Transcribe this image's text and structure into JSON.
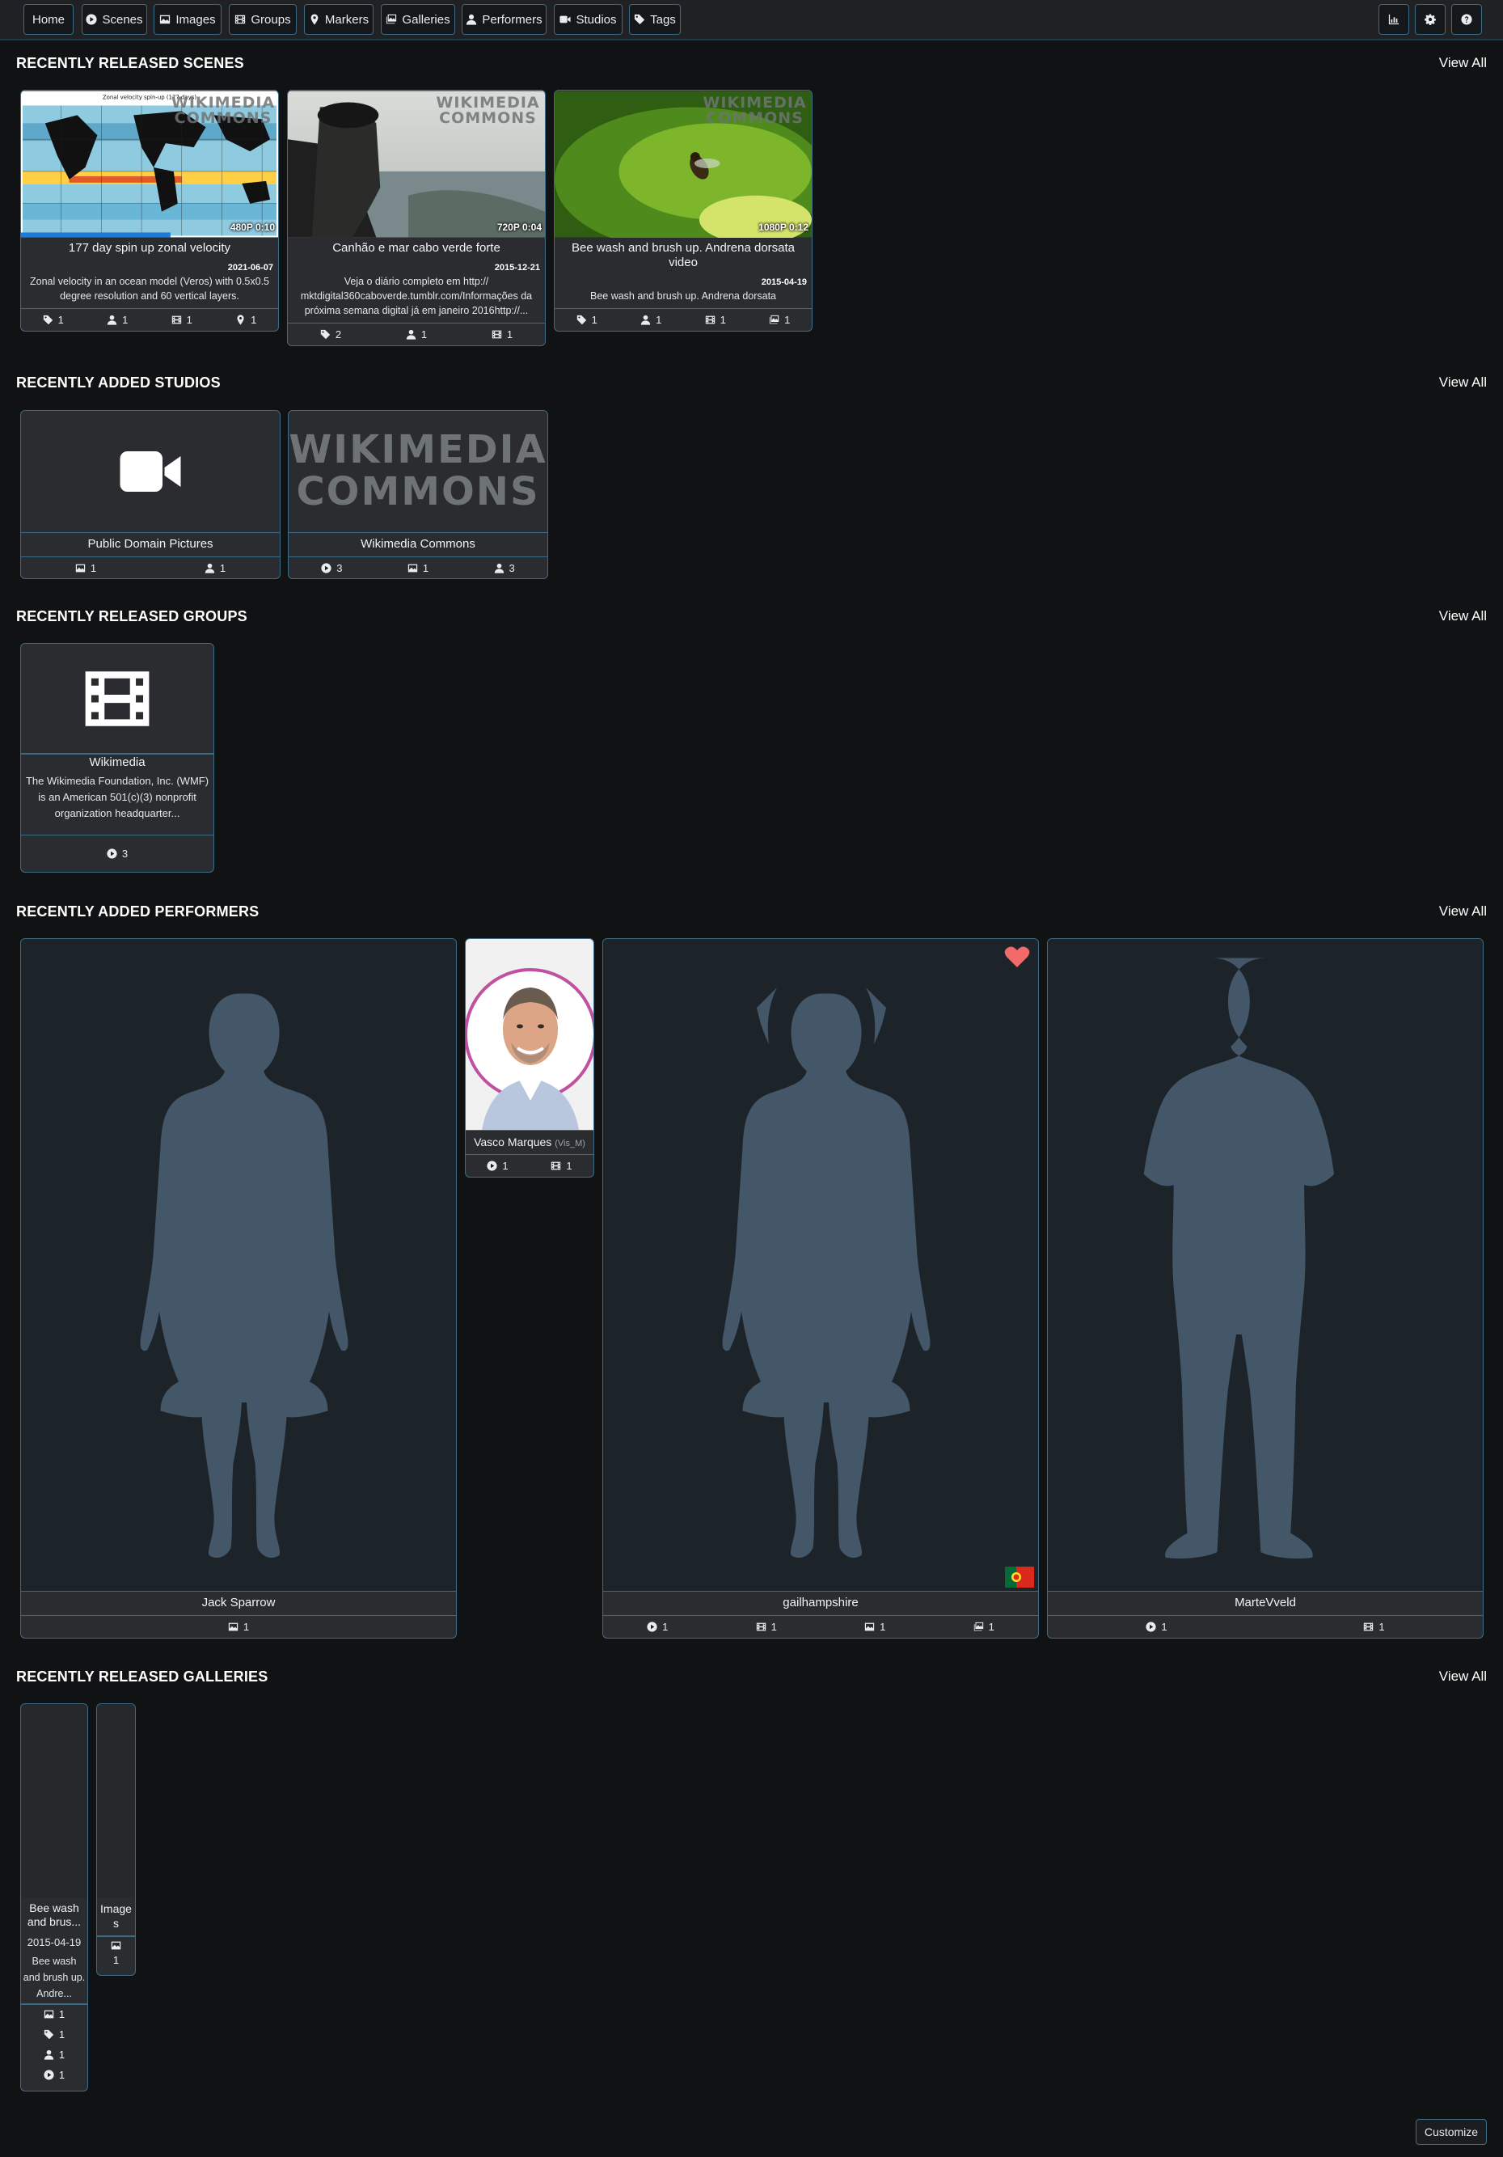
{
  "nav": {
    "items": [
      {
        "label": "Home",
        "icon": ""
      },
      {
        "label": "Scenes",
        "icon": "play-circle-icon"
      },
      {
        "label": "Images",
        "icon": "image-icon"
      },
      {
        "label": "Groups",
        "icon": "film-icon"
      },
      {
        "label": "Markers",
        "icon": "map-marker-icon"
      },
      {
        "label": "Galleries",
        "icon": "images-icon"
      },
      {
        "label": "Performers",
        "icon": "user-icon"
      },
      {
        "label": "Studios",
        "icon": "video-camera-icon"
      },
      {
        "label": "Tags",
        "icon": "tag-icon"
      }
    ],
    "right_icons": [
      "stats-chart-icon",
      "gear-icon",
      "help-icon"
    ]
  },
  "sections": {
    "scenes": {
      "title": "RECENTLY RELEASED SCENES",
      "view_all": "View All"
    },
    "studios": {
      "title": "RECENTLY ADDED STUDIOS",
      "view_all": "View All"
    },
    "groups": {
      "title": "RECENTLY RELEASED GROUPS",
      "view_all": "View All"
    },
    "performers": {
      "title": "RECENTLY ADDED PERFORMERS",
      "view_all": "View All"
    },
    "galleries": {
      "title": "RECENTLY RELEASED GALLERIES",
      "view_all": "View All"
    }
  },
  "scenes": [
    {
      "title": "177 day spin up zonal velocity",
      "resolution": "480P",
      "duration": "0:10",
      "date": "2021-06-07",
      "description": "Zonal velocity in an ocean model (Veros) with 0.5x0.5 degree resolution and 60 vertical layers.",
      "thumb_caption": "Zonal velocity spin-up (177 days)",
      "watermark": "WIKIMEDIA COMMONS",
      "progress": 0.58,
      "stats": {
        "tags": "1",
        "performers": "1",
        "groups": "1",
        "markers": "1"
      }
    },
    {
      "title": "Canhão e mar cabo verde forte",
      "resolution": "720P",
      "duration": "0:04",
      "date": "2015-12-21",
      "description": "Veja o diário completo em http:// mktdigital360caboverde.tumblr.com/Informações da próxima semana digital já em janeiro 2016http://...",
      "watermark": "WIKIMEDIA COMMONS",
      "stats": {
        "tags": "2",
        "performers": "1",
        "groups": "1"
      }
    },
    {
      "title": "Bee wash and brush up. Andrena dorsata video",
      "resolution": "1080P",
      "duration": "0:12",
      "date": "2015-04-19",
      "description": "Bee wash and brush up. Andrena dorsata",
      "watermark": "WIKIMEDIA COMMONS",
      "stats": {
        "tags": "1",
        "performers": "1",
        "groups": "1",
        "galleries": "1"
      }
    }
  ],
  "studios": [
    {
      "name": "Public Domain Pictures",
      "stats": {
        "images": "1",
        "performers": "1"
      }
    },
    {
      "name": "Wikimedia Commons",
      "logo_text": "WIKIMEDIA COMMONS",
      "stats": {
        "scenes": "3",
        "images": "1",
        "performers": "3"
      }
    }
  ],
  "groups": [
    {
      "name": "Wikimedia",
      "description": "The Wikimedia Foundation, Inc. (WMF) is an American 501(c)(3) nonprofit organization headquarter...",
      "stats": {
        "scenes": "3"
      }
    }
  ],
  "performers": [
    {
      "name": "Jack Sparrow",
      "stats": {
        "images": "1"
      }
    },
    {
      "name": "Vasco Marques",
      "disambiguation": "(Vis_M)",
      "stats": {
        "scenes": "1",
        "groups": "1"
      }
    },
    {
      "name": "gailhampshire",
      "favorite": true,
      "flag": "Portugal",
      "stats": {
        "scenes": "1",
        "groups": "1",
        "images": "1",
        "galleries": "1"
      }
    },
    {
      "name": "MarteVveld",
      "stats": {
        "scenes": "1",
        "groups": "1"
      }
    }
  ],
  "galleries": [
    {
      "title": "Bee wash and brus...",
      "date": "2015-04-19",
      "description": "Bee wash and brush up. Andre...",
      "stats": {
        "images": "1",
        "tags": "1",
        "performers": "1",
        "scenes": "1"
      }
    },
    {
      "title": "Images",
      "stats": {
        "images": "1"
      }
    }
  ],
  "customize_label": "Customize",
  "colors": {
    "accent_border": "#3d6b86",
    "background": "#111213",
    "card": "#2a2c30",
    "silhouette": "#435769",
    "favorite": "#f26a6a"
  }
}
